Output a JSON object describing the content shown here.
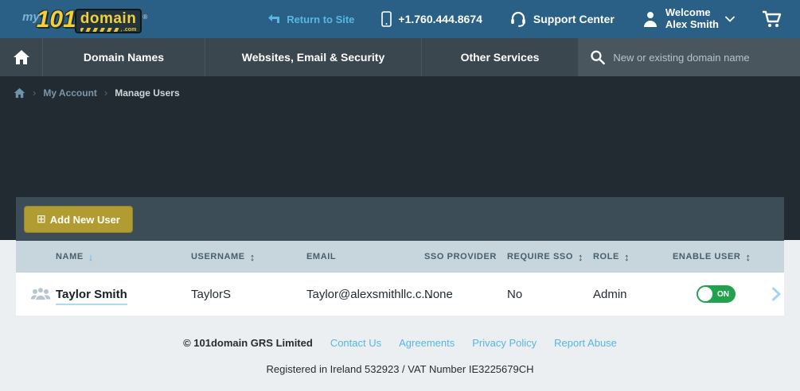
{
  "brand": {
    "my": "my",
    "number": "101",
    "domain": "domain",
    "tld": ".com",
    "reg": "®"
  },
  "topbar": {
    "return_to_site": "Return to Site",
    "phone": "+1.760.444.8674",
    "support_center": "Support Center",
    "welcome_line1": "Welcome",
    "welcome_line2": "Alex Smith"
  },
  "nav": {
    "items": {
      "0": "Domain Names",
      "1": "Websites, Email & Security",
      "2": "Other Services"
    },
    "search_placeholder": "New or existing domain name"
  },
  "breadcrumb": {
    "items": {
      "0": "My Account",
      "1": "Manage Users"
    }
  },
  "page": {
    "title": "Manage Users"
  },
  "toolbar": {
    "add_user_label": "Add New User"
  },
  "table": {
    "headers": {
      "name": "NAME",
      "username": "USERNAME",
      "email": "EMAIL",
      "sso_provider": "SSO PROVIDER",
      "require_sso": "REQUIRE SSO",
      "role": "ROLE",
      "enable_user": "ENABLE USER"
    },
    "rows": {
      "0": {
        "name": "Taylor Smith",
        "username": "TaylorS",
        "email": "Taylor@alexsmithllc.c...",
        "sso_provider": "None",
        "require_sso": "No",
        "role": "Admin",
        "enabled_label": "ON"
      }
    }
  },
  "footer": {
    "copyright": "© 101domain GRS Limited",
    "links": {
      "0": "Contact Us",
      "1": "Agreements",
      "2": "Privacy Policy",
      "3": "Report Abuse"
    },
    "registered": "Registered in Ireland 532923 / VAT Number IE3225679CH"
  },
  "icons": {
    "sort_down": "↓",
    "sort_both": "↕",
    "plus_square": "⊞",
    "breadcrumb_sep": "›"
  },
  "colors": {
    "topbar_bg": "#2a6086",
    "nav_bg": "#3b474f",
    "dark_bg": "#222b31",
    "card_toolbar_bg": "#3d4d58",
    "table_header_bg": "#c7d5dc",
    "gold_button": "#b19c31",
    "toggle_green": "#23a24d",
    "link_blue": "#56b6e4",
    "light_bg": "#eceff2"
  }
}
